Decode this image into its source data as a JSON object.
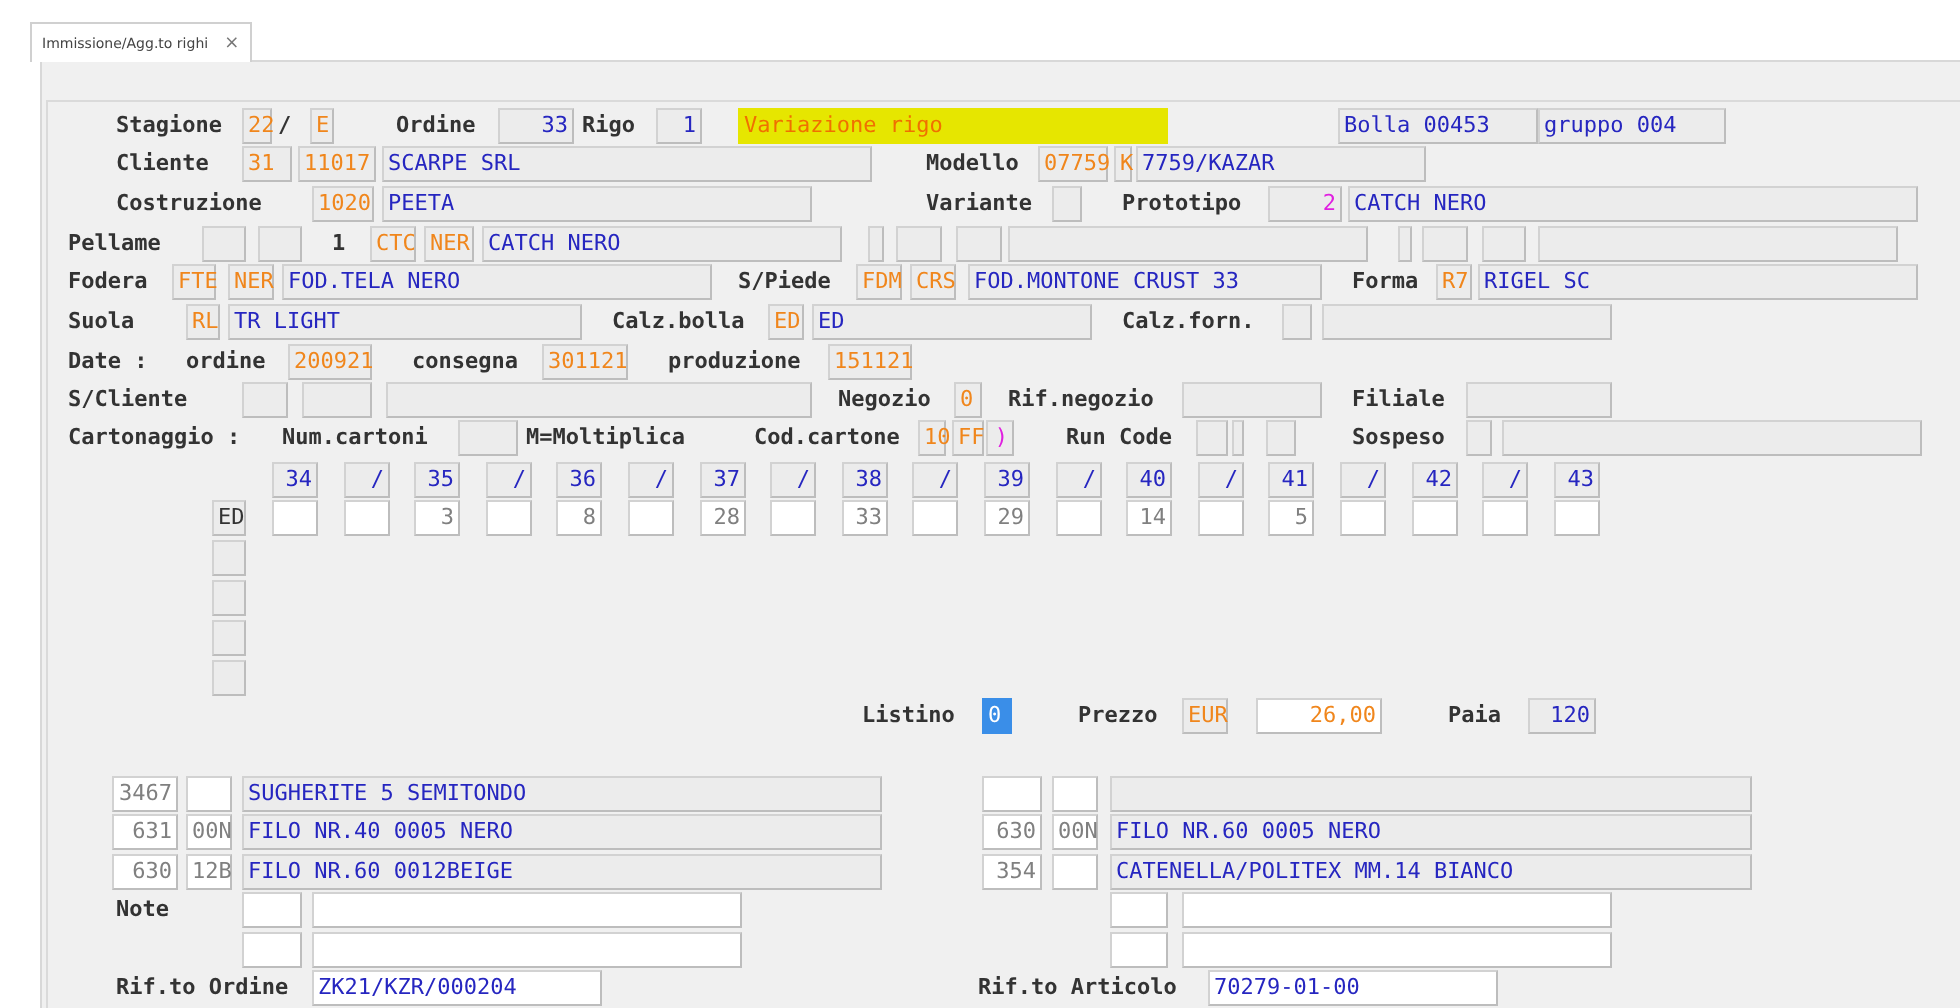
{
  "tab": {
    "title": "Immissione/Agg.to righi",
    "close": "×",
    "selected": true
  },
  "rows": [
    {
      "items": [
        {
          "kind": "label",
          "text": "Stagione"
        },
        {
          "kind": "code",
          "text": "22"
        },
        {
          "kind": "label",
          "text": "/"
        },
        {
          "kind": "code",
          "text": "E"
        },
        {
          "kind": "label",
          "text": "Ordine"
        },
        {
          "kind": "size",
          "text": "33"
        },
        {
          "kind": "label",
          "text": "Rigo"
        },
        {
          "kind": "size",
          "text": "1"
        },
        {
          "kind": "status",
          "text": "Variazione rigo"
        },
        {
          "kind": "desc",
          "text": "Bolla 00453"
        },
        {
          "kind": "desc",
          "text": "gruppo 004"
        }
      ]
    },
    {
      "items": [
        {
          "kind": "label",
          "text": "Cliente"
        },
        {
          "kind": "code",
          "text": "31"
        },
        {
          "kind": "code",
          "text": "11017"
        },
        {
          "kind": "desc",
          "text": "SCARPE SRL"
        },
        {
          "kind": "label",
          "text": "Modello"
        },
        {
          "kind": "code",
          "text": "07759"
        },
        {
          "kind": "code",
          "text": "K"
        },
        {
          "kind": "desc",
          "text": "7759/KAZAR"
        }
      ]
    },
    {
      "items": [
        {
          "kind": "label",
          "text": "Costruzione"
        },
        {
          "kind": "code",
          "text": "1020"
        },
        {
          "kind": "desc",
          "text": "PEETA"
        },
        {
          "kind": "label",
          "text": "Variante"
        },
        {
          "kind": "blank"
        },
        {
          "kind": "label",
          "text": "Prototipo"
        },
        {
          "kind": "flag",
          "text": "2"
        },
        {
          "kind": "desc",
          "text": "CATCH NERO"
        }
      ]
    },
    {
      "items": [
        {
          "kind": "label",
          "text": "Pellame"
        },
        {
          "kind": "blank"
        },
        {
          "kind": "blank"
        },
        {
          "kind": "label",
          "text": "1"
        },
        {
          "kind": "code",
          "text": "CTC"
        },
        {
          "kind": "code",
          "text": "NER"
        },
        {
          "kind": "desc",
          "text": "CATCH NERO"
        },
        {
          "kind": "blank"
        },
        {
          "kind": "blank"
        },
        {
          "kind": "blank"
        },
        {
          "kind": "blank"
        },
        {
          "kind": "blank"
        },
        {
          "kind": "blank"
        },
        {
          "kind": "blank"
        },
        {
          "kind": "blank"
        }
      ]
    },
    {
      "items": [
        {
          "kind": "label",
          "text": "Fodera"
        },
        {
          "kind": "code",
          "text": "FTE"
        },
        {
          "kind": "code",
          "text": "NER"
        },
        {
          "kind": "desc",
          "text": "FOD.TELA NERO"
        },
        {
          "kind": "label",
          "text": "S/Piede"
        },
        {
          "kind": "code",
          "text": "FDM"
        },
        {
          "kind": "code",
          "text": "CRS"
        },
        {
          "kind": "desc",
          "text": "FOD.MONTONE CRUST 33"
        },
        {
          "kind": "label",
          "text": "Forma"
        },
        {
          "kind": "code",
          "text": "R7"
        },
        {
          "kind": "desc",
          "text": "RIGEL SC"
        }
      ]
    },
    {
      "items": [
        {
          "kind": "label",
          "text": "Suola"
        },
        {
          "kind": "code",
          "text": "RL"
        },
        {
          "kind": "desc",
          "text": "TR LIGHT"
        },
        {
          "kind": "label",
          "text": "Calz.bolla"
        },
        {
          "kind": "code",
          "text": "ED"
        },
        {
          "kind": "desc",
          "text": "ED"
        },
        {
          "kind": "label",
          "text": "Calz.forn."
        },
        {
          "kind": "blank"
        },
        {
          "kind": "blank"
        }
      ]
    },
    {
      "items": [
        {
          "kind": "label",
          "text": "Date :"
        },
        {
          "kind": "label",
          "text": "ordine"
        },
        {
          "kind": "code",
          "text": "200921"
        },
        {
          "kind": "label",
          "text": "consegna"
        },
        {
          "kind": "code",
          "text": "301121"
        },
        {
          "kind": "label",
          "text": "produzione"
        },
        {
          "kind": "code",
          "text": "151121"
        }
      ]
    },
    {
      "items": [
        {
          "kind": "label",
          "text": "S/Cliente"
        },
        {
          "kind": "blank"
        },
        {
          "kind": "blank"
        },
        {
          "kind": "blank"
        },
        {
          "kind": "label",
          "text": "Negozio"
        },
        {
          "kind": "code",
          "text": "0"
        },
        {
          "kind": "label",
          "text": "Rif.negozio"
        },
        {
          "kind": "blank"
        },
        {
          "kind": "label",
          "text": "Filiale"
        },
        {
          "kind": "blank"
        }
      ]
    },
    {
      "items": [
        {
          "kind": "label",
          "text": "Cartonaggio :"
        },
        {
          "kind": "label",
          "text": "Num.cartoni"
        },
        {
          "kind": "blank"
        },
        {
          "kind": "label",
          "text": "M=Moltiplica"
        },
        {
          "kind": "label",
          "text": "Cod.cartone"
        },
        {
          "kind": "code",
          "text": "10"
        },
        {
          "kind": "code",
          "text": "FF"
        },
        {
          "kind": "flag",
          "text": ")"
        },
        {
          "kind": "label",
          "text": "Run Code"
        },
        {
          "kind": "blank"
        },
        {
          "kind": "blank"
        },
        {
          "kind": "blank"
        },
        {
          "kind": "label",
          "text": "Sospeso"
        },
        {
          "kind": "blank"
        },
        {
          "kind": "blank"
        }
      ]
    },
    {
      "items": [
        {
          "kind": "size",
          "text": "34"
        },
        {
          "kind": "size",
          "text": "/"
        },
        {
          "kind": "size",
          "text": "35"
        },
        {
          "kind": "size",
          "text": "/"
        },
        {
          "kind": "size",
          "text": "36"
        },
        {
          "kind": "size",
          "text": "/"
        },
        {
          "kind": "size",
          "text": "37"
        },
        {
          "kind": "size",
          "text": "/"
        },
        {
          "kind": "size",
          "text": "38"
        },
        {
          "kind": "size",
          "text": "/"
        },
        {
          "kind": "size",
          "text": "39"
        },
        {
          "kind": "size",
          "text": "/"
        },
        {
          "kind": "size",
          "text": "40"
        },
        {
          "kind": "size",
          "text": "/"
        },
        {
          "kind": "size",
          "text": "41"
        },
        {
          "kind": "size",
          "text": "/"
        },
        {
          "kind": "size",
          "text": "42"
        },
        {
          "kind": "size",
          "text": "/"
        },
        {
          "kind": "size",
          "text": "43"
        }
      ]
    },
    {
      "items": [
        {
          "kind": "mark",
          "text": "ED"
        },
        {
          "kind": "white"
        },
        {
          "kind": "white"
        },
        {
          "kind": "qty",
          "text": "3"
        },
        {
          "kind": "white"
        },
        {
          "kind": "qty",
          "text": "8"
        },
        {
          "kind": "white"
        },
        {
          "kind": "qty",
          "text": "28"
        },
        {
          "kind": "white"
        },
        {
          "kind": "qty",
          "text": "33"
        },
        {
          "kind": "white"
        },
        {
          "kind": "qty",
          "text": "29"
        },
        {
          "kind": "white"
        },
        {
          "kind": "qty",
          "text": "14"
        },
        {
          "kind": "white"
        },
        {
          "kind": "qty",
          "text": "5"
        },
        {
          "kind": "white"
        },
        {
          "kind": "white"
        },
        {
          "kind": "white"
        },
        {
          "kind": "white"
        }
      ]
    },
    {
      "items": [
        {
          "kind": "blank"
        }
      ]
    },
    {
      "items": [
        {
          "kind": "blank"
        }
      ]
    },
    {
      "items": [
        {
          "kind": "blank"
        }
      ]
    },
    {
      "items": [
        {
          "kind": "blank"
        }
      ]
    },
    {
      "items": [
        {
          "kind": "label",
          "text": "Listino"
        },
        {
          "kind": "cursor",
          "text": "0"
        },
        {
          "kind": "label",
          "text": "Prezzo"
        },
        {
          "kind": "code",
          "text": "EUR"
        },
        {
          "kind": "amount",
          "text": "26,00"
        },
        {
          "kind": "label",
          "text": "Paia"
        },
        {
          "kind": "size",
          "text": "120"
        }
      ]
    },
    {
      "items": [
        {
          "kind": "qty",
          "text": "3467"
        },
        {
          "kind": "white"
        },
        {
          "kind": "desc",
          "text": "SUGHERITE 5 SEMITONDO"
        },
        {
          "kind": "white"
        },
        {
          "kind": "white"
        },
        {
          "kind": "blank"
        }
      ]
    },
    {
      "items": [
        {
          "kind": "qty",
          "text": "631"
        },
        {
          "kind": "qty",
          "text": "00N"
        },
        {
          "kind": "desc",
          "text": "FILO NR.40 0005 NERO"
        },
        {
          "kind": "qty",
          "text": "630"
        },
        {
          "kind": "qty",
          "text": "00N"
        },
        {
          "kind": "desc",
          "text": "FILO NR.60 0005 NERO"
        }
      ]
    },
    {
      "items": [
        {
          "kind": "qty",
          "text": "630"
        },
        {
          "kind": "qty",
          "text": "12B"
        },
        {
          "kind": "desc",
          "text": "FILO NR.60 0012BEIGE"
        },
        {
          "kind": "qty",
          "text": "354"
        },
        {
          "kind": "white"
        },
        {
          "kind": "desc",
          "text": "CATENELLA/POLITEX MM.14 BIANCO"
        }
      ]
    },
    {
      "items": [
        {
          "kind": "label",
          "text": "Note"
        },
        {
          "kind": "white"
        },
        {
          "kind": "white"
        },
        {
          "kind": "white"
        },
        {
          "kind": "white"
        }
      ]
    },
    {
      "items": [
        {
          "kind": "white"
        },
        {
          "kind": "white"
        },
        {
          "kind": "white"
        },
        {
          "kind": "white"
        }
      ]
    },
    {
      "items": [
        {
          "kind": "label",
          "text": "Rif.to Ordine"
        },
        {
          "kind": "entry",
          "text": "ZK21/KZR/000204"
        },
        {
          "kind": "label",
          "text": "Rif.to Articolo"
        },
        {
          "kind": "entry",
          "text": "70279-01-00"
        }
      ]
    }
  ]
}
